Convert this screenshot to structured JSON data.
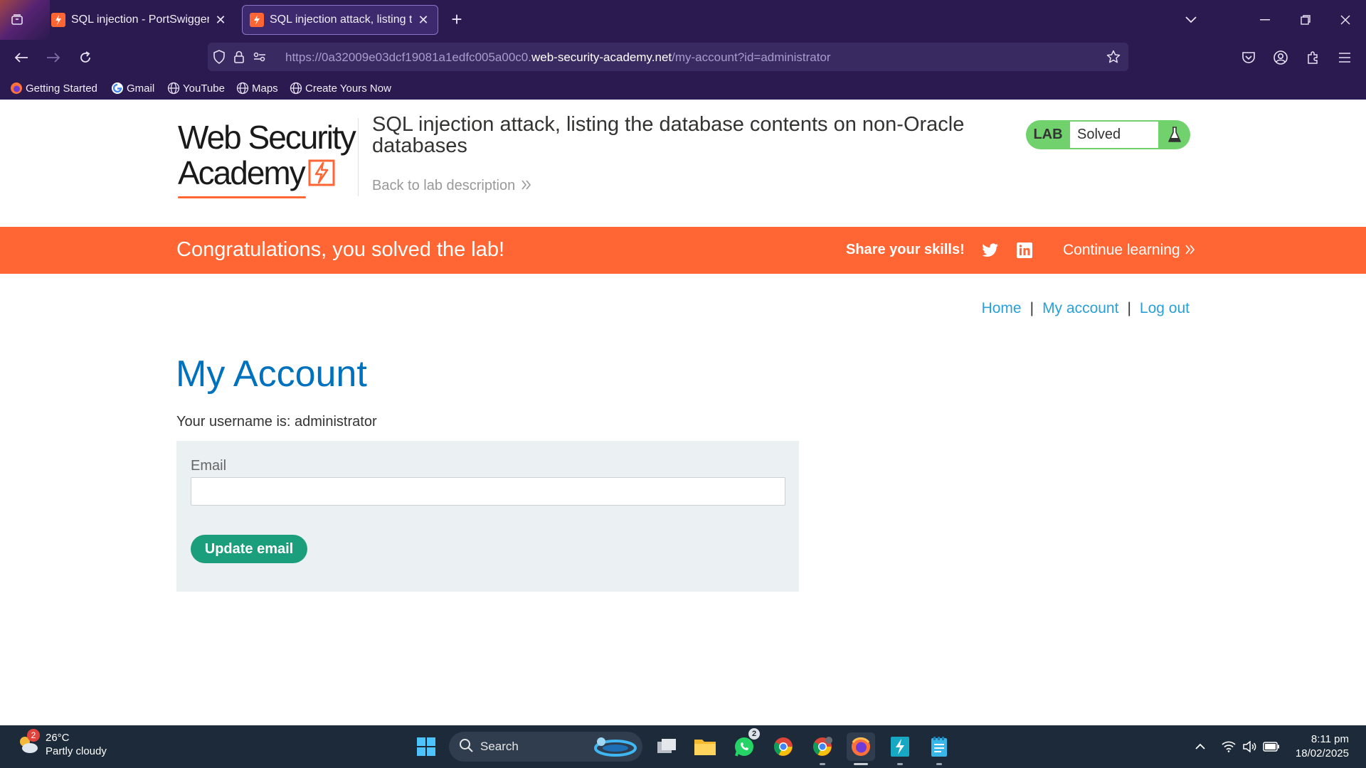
{
  "browser": {
    "tabs": [
      {
        "label": "SQL injection - PortSwigger",
        "active": false
      },
      {
        "label": "SQL injection attack, listing the",
        "active": true
      }
    ],
    "url": {
      "prefix": "https://0a32009e03dcf19081a1edfc005a00c0.",
      "host": "web-security-academy.net",
      "path": "/my-account?id=administrator"
    },
    "bookmarks": [
      {
        "label": "Getting Started",
        "icon": "firefox-icon"
      },
      {
        "label": "Gmail",
        "icon": "google-icon"
      },
      {
        "label": "YouTube",
        "icon": "globe-icon"
      },
      {
        "label": "Maps",
        "icon": "globe-icon"
      },
      {
        "label": "Create Yours Now",
        "icon": "globe-icon"
      }
    ]
  },
  "header": {
    "logo_line1": "Web Security",
    "logo_line2": "Academy",
    "lab_title": "SQL injection attack, listing the database contents on non-Oracle databases",
    "back_link": "Back to lab description",
    "lab_tag": "LAB",
    "lab_status": "Solved"
  },
  "banner": {
    "congrats": "Congratulations, you solved the lab!",
    "share": "Share your skills!",
    "continue": "Continue learning"
  },
  "nav": {
    "home": "Home",
    "sep": "|",
    "my_account": "My account",
    "log_out": "Log out"
  },
  "main": {
    "title": "My Account",
    "username_line": "Your username is: administrator",
    "email_label": "Email",
    "email_value": "",
    "update_button": "Update email"
  },
  "taskbar": {
    "weather_temp": "26°C",
    "weather_desc": "Partly cloudy",
    "weather_badge": "2",
    "search_label": "Search",
    "whatsapp_badge": "2",
    "time": "8:11 pm",
    "date": "18/02/2025"
  },
  "colors": {
    "accent_orange": "#ff6633",
    "title_blue": "#0071bc",
    "link_blue": "#29a0d8",
    "solved_green": "#70d16d",
    "button_green": "#1a9e7b",
    "browser_purple": "#2b1a4f"
  }
}
